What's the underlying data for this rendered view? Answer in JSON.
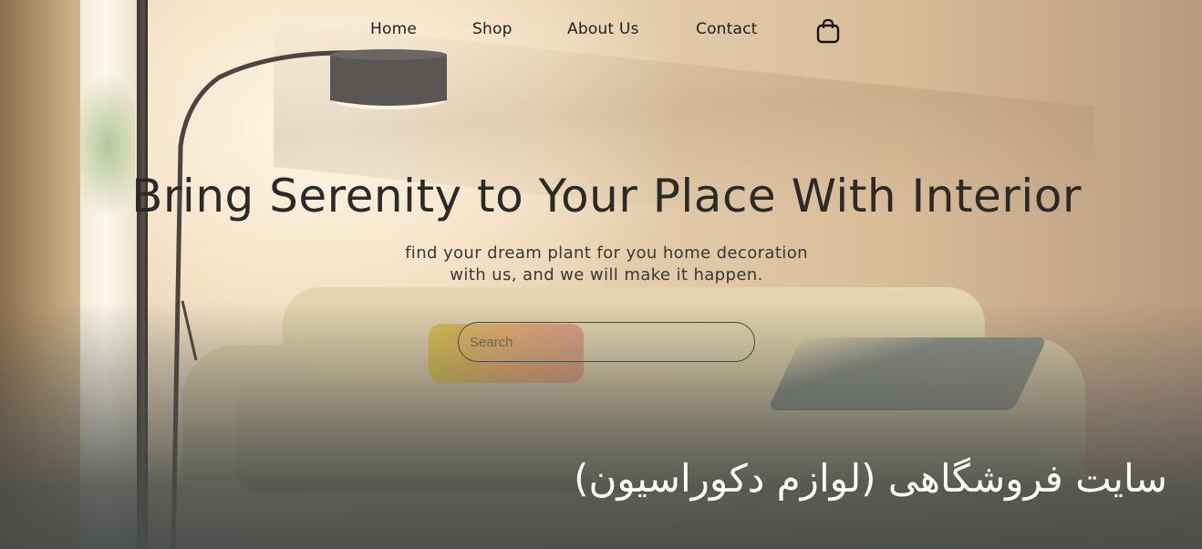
{
  "nav": {
    "items": [
      {
        "label": "Home"
      },
      {
        "label": "Shop"
      },
      {
        "label": "About Us"
      },
      {
        "label": "Contact"
      }
    ],
    "cart_icon": "shopping-bag-icon"
  },
  "hero": {
    "title": "Bring Serenity to Your Place With Interior",
    "subtitle_line1": "find your dream plant for you home decoration",
    "subtitle_line2": "with us, and we will make it happen."
  },
  "search": {
    "placeholder": "Search",
    "value": ""
  },
  "caption": "سایت فروشگاهی (لوازم دکوراسیون)",
  "colors": {
    "text_dark": "#2a2a28",
    "caption": "#ffffff"
  }
}
